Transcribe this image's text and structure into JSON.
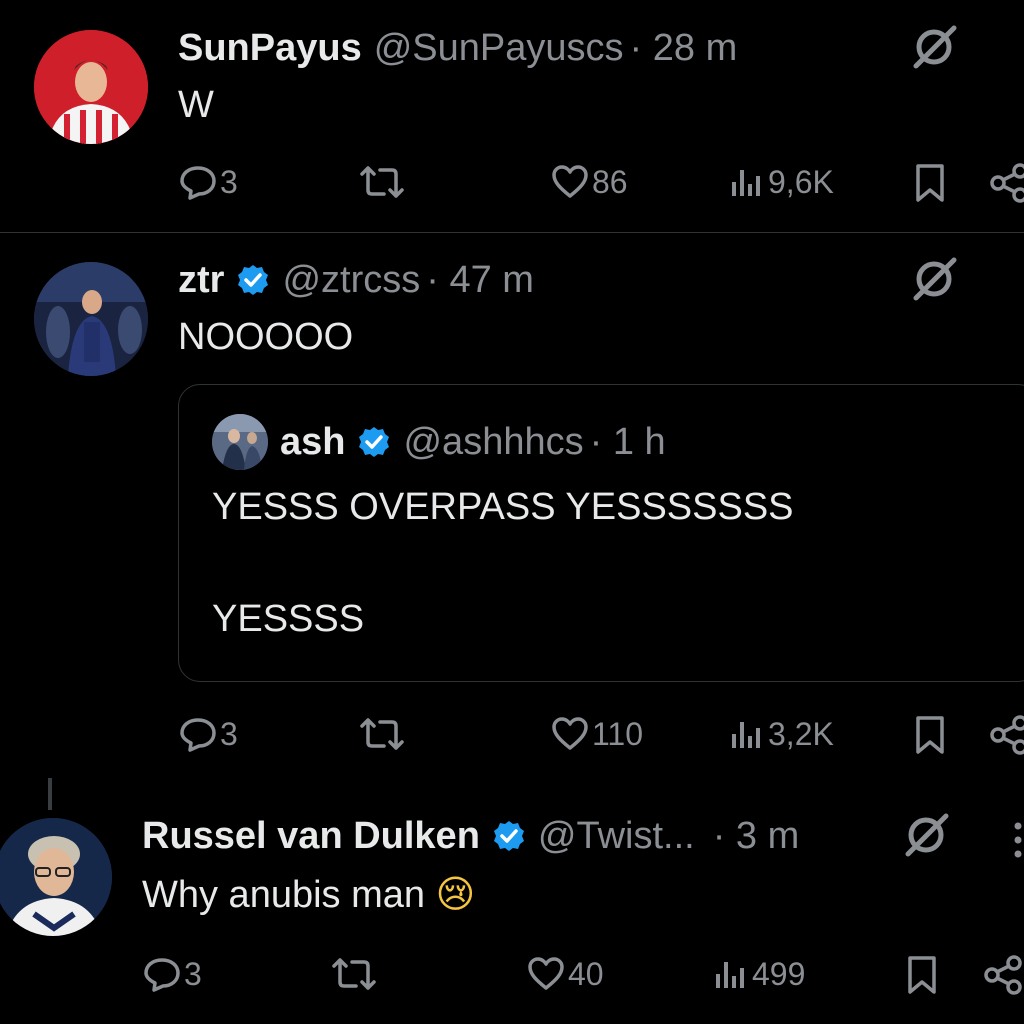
{
  "tweets": [
    {
      "name": "SunPayus",
      "handle": "@SunPayuscs",
      "time": "· 28 m",
      "text": "W",
      "replies": "3",
      "likes": "86",
      "views": "9,6K"
    },
    {
      "name": "ztr",
      "handle": "@ztrcss",
      "time": "· 47 m",
      "text": "NOOOOO",
      "replies": "3",
      "likes": "110",
      "views": "3,2K",
      "quote": {
        "name": "ash",
        "handle": "@ashhhcs",
        "time": "· 1 h",
        "line1": "YESSS OVERPASS YESSSSSSS",
        "line2": "YESSSS"
      }
    },
    {
      "name": "Russel van Dulken",
      "handle": "@Twist...",
      "time": "· 3 m",
      "text": "Why anubis man",
      "emoji": "😢",
      "replies": "3",
      "likes": "40",
      "views": "499"
    }
  ],
  "colors": {
    "background": "#000000",
    "text": "#e7e9ea",
    "muted": "#8b8f94",
    "verified": "#1d9bf0",
    "divider": "#2f3336"
  },
  "icons": [
    "reply-icon",
    "repost-icon",
    "like-icon",
    "views-icon",
    "bookmark-icon",
    "share-icon",
    "grok-icon",
    "verified-badge-icon",
    "more-icon"
  ]
}
